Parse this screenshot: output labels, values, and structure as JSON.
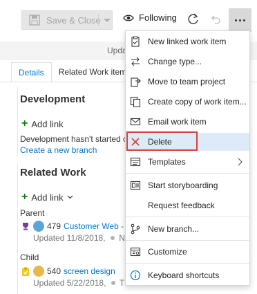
{
  "toolbar": {
    "save_close_label": "Save & Close",
    "following_label": "Following"
  },
  "page": {
    "updated_text": "Upda",
    "tabs": [
      {
        "label": "Details"
      },
      {
        "label": "Related Work item"
      }
    ],
    "development": {
      "title": "Development",
      "add_link": "Add link",
      "status_text": "Development hasn't started o",
      "create_branch": "Create a new branch"
    },
    "related_work": {
      "title": "Related Work",
      "add_link": "Add link",
      "parent_label": "Parent",
      "parent_item": {
        "id": "479",
        "title": "Customer Web -",
        "updated": "Updated 11/8/2018,",
        "state_prefix": "N"
      },
      "child_label": "Child",
      "child_item": {
        "id": "540",
        "title": "screen design",
        "updated": "Updated 5/22/2018,",
        "state_prefix": "T"
      }
    }
  },
  "menu": {
    "items": [
      {
        "label": "New linked work item",
        "icon": "new-linked-work-item-icon"
      },
      {
        "label": "Change type...",
        "icon": "change-type-icon"
      },
      {
        "label": "Move to team project",
        "icon": "move-to-team-project-icon"
      },
      {
        "label": "Create copy of work item...",
        "icon": "copy-work-item-icon"
      },
      {
        "label": "Email work item",
        "icon": "email-icon"
      },
      {
        "label": "Delete",
        "icon": "delete-icon"
      },
      {
        "label": "Templates",
        "icon": "templates-icon"
      },
      {
        "label": "Start storyboarding",
        "icon": "storyboard-icon"
      },
      {
        "label": "Request feedback",
        "icon": ""
      },
      {
        "label": "New branch...",
        "icon": "branch-icon"
      },
      {
        "label": "Customize",
        "icon": "customize-icon"
      },
      {
        "label": "Keyboard shortcuts",
        "icon": "info-icon"
      }
    ]
  },
  "colors": {
    "accent": "#0078d4",
    "delete_red": "#d9413a",
    "highlight": "#dcebf7",
    "add_green": "#107c10"
  }
}
